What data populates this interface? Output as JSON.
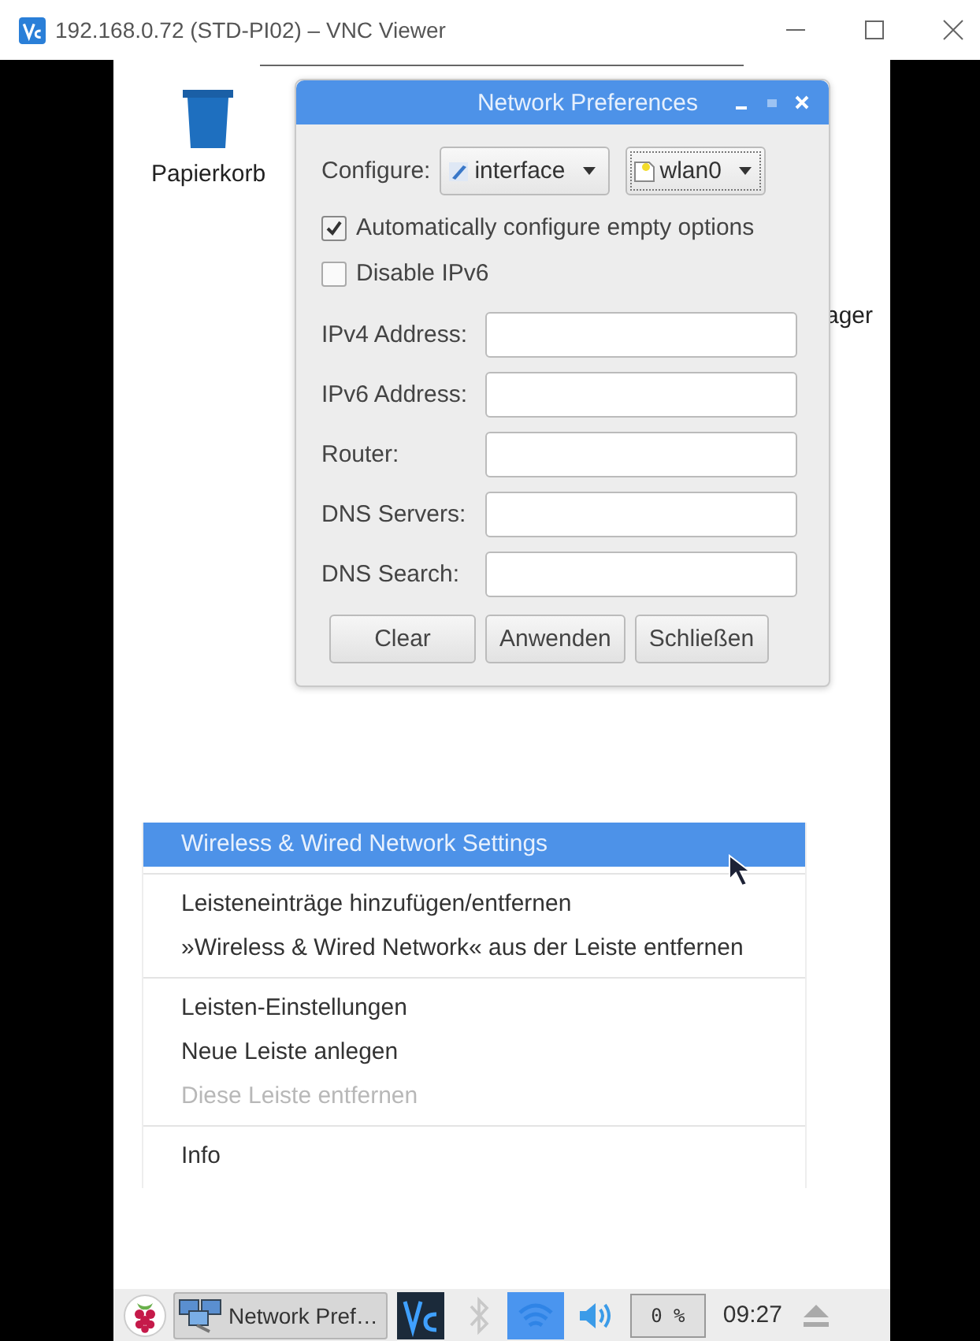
{
  "window": {
    "title": "192.168.0.72 (STD-PI02) – VNC Viewer"
  },
  "desktop": {
    "icons": [
      {
        "label": "Papierkorb"
      },
      {
        "label": "ager"
      }
    ]
  },
  "dialog": {
    "title": "Network Preferences",
    "configure_label": "Configure:",
    "dropdowns": [
      {
        "value": "interface"
      },
      {
        "value": "wlan0"
      }
    ],
    "checkboxes": [
      {
        "label": "Automatically configure empty options",
        "checked": true
      },
      {
        "label": "Disable IPv6",
        "checked": false
      }
    ],
    "fields": [
      {
        "label": "IPv4 Address:"
      },
      {
        "label": "IPv6 Address:"
      },
      {
        "label": "Router:"
      },
      {
        "label": "DNS Servers:"
      },
      {
        "label": "DNS Search:"
      }
    ],
    "buttons": [
      "Clear",
      "Anwenden",
      "Schließen"
    ]
  },
  "context_menu": {
    "groups": [
      [
        {
          "label": "Wireless & Wired Network Settings",
          "selected": true,
          "disabled": false
        }
      ],
      [
        {
          "label": "Leisteneinträge hinzufügen/entfernen",
          "selected": false,
          "disabled": false
        },
        {
          "label": "»Wireless & Wired Network« aus der Leiste entfernen",
          "selected": false,
          "disabled": false
        }
      ],
      [
        {
          "label": "Leisten-Einstellungen",
          "selected": false,
          "disabled": false
        },
        {
          "label": "Neue Leiste anlegen",
          "selected": false,
          "disabled": false
        },
        {
          "label": "Diese Leiste entfernen",
          "selected": false,
          "disabled": true
        }
      ],
      [
        {
          "label": "Info",
          "selected": false,
          "disabled": false
        }
      ]
    ]
  },
  "taskbar": {
    "task": "Network Pref…",
    "network_active": true,
    "cpu": "0 %",
    "clock": "09:27"
  }
}
